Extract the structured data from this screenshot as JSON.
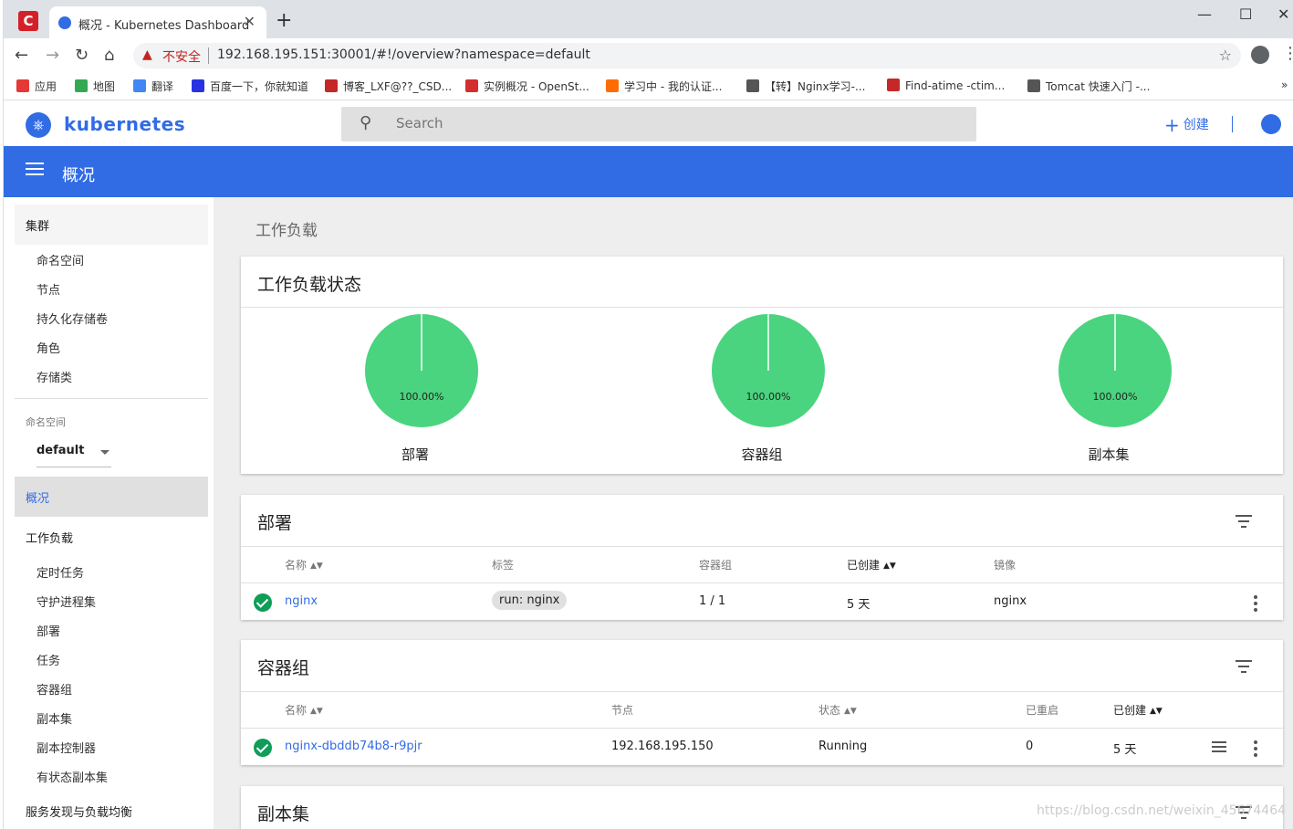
{
  "browser": {
    "tab_title": "概况 - Kubernetes Dashboard",
    "tab_close": "✕",
    "new_tab": "+",
    "app_icon": "C",
    "window": {
      "minimize": "—",
      "maximize": "☐",
      "close": "✕"
    },
    "nav": {
      "back": "←",
      "forward": "→",
      "reload": "↻",
      "home": "⌂"
    },
    "address": {
      "insecure_label": "不安全",
      "url": "192.168.195.151:30001/#!/overview?namespace=default"
    },
    "bookmarks": [
      {
        "label": "应用",
        "color": "#e53935"
      },
      {
        "label": "地图",
        "color": "#34a853"
      },
      {
        "label": "翻译",
        "color": "#4285f4"
      },
      {
        "label": "百度一下，你就知道",
        "color": "#2932e1"
      },
      {
        "label": "博客_LXF@??_CSD...",
        "color": "#c62828"
      },
      {
        "label": "实例概况 - OpenSt...",
        "color": "#d32f2f"
      },
      {
        "label": "学习中 - 我的认证...",
        "color": "#ff6d00"
      },
      {
        "label": "【转】Nginx学习-...",
        "color": "#555555"
      },
      {
        "label": "Find-atime -ctim...",
        "color": "#c62828"
      },
      {
        "label": "Tomcat 快速入门 -...",
        "color": "#555555"
      }
    ],
    "bookmarks_more": "»"
  },
  "app": {
    "brand": "kubernetes",
    "search_placeholder": "Search",
    "create_label": "创建",
    "toolbar_title": "概况",
    "accent": "#326ce5"
  },
  "sidebar": {
    "cluster": "集群",
    "cluster_items": [
      "命名空间",
      "节点",
      "持久化存储卷",
      "角色",
      "存储类"
    ],
    "namespace_label": "命名空间",
    "namespace_value": "default",
    "overview": "概况",
    "workloads": "工作负载",
    "workload_items": [
      "定时任务",
      "守护进程集",
      "部署",
      "任务",
      "容器组",
      "副本集",
      "副本控制器",
      "有状态副本集"
    ],
    "discovery": "服务发现与负载均衡"
  },
  "main": {
    "section_title": "工作负载",
    "status_card": {
      "title": "工作负载状态",
      "pies": [
        {
          "label": "部署",
          "percent": "100.00%",
          "value": 100
        },
        {
          "label": "容器组",
          "percent": "100.00%",
          "value": 100
        },
        {
          "label": "副本集",
          "percent": "100.00%",
          "value": 100
        }
      ],
      "pie_color": "#4ad47f"
    },
    "deployments": {
      "title": "部署",
      "headers": [
        "名称",
        "标签",
        "容器组",
        "已创建",
        "镜像"
      ],
      "row": {
        "name": "nginx",
        "label": "run: nginx",
        "pods": "1 / 1",
        "created": "5 天",
        "image": "nginx"
      }
    },
    "pods": {
      "title": "容器组",
      "headers": [
        "名称",
        "节点",
        "状态",
        "已重启",
        "已创建"
      ],
      "row": {
        "name": "nginx-dbddb74b8-r9pjr",
        "node": "192.168.195.150",
        "status": "Running",
        "restarts": "0",
        "created": "5 天"
      }
    },
    "replicasets": {
      "title": "副本集"
    }
  },
  "watermark": "https://blog.csdn.net/weixin_45674464"
}
